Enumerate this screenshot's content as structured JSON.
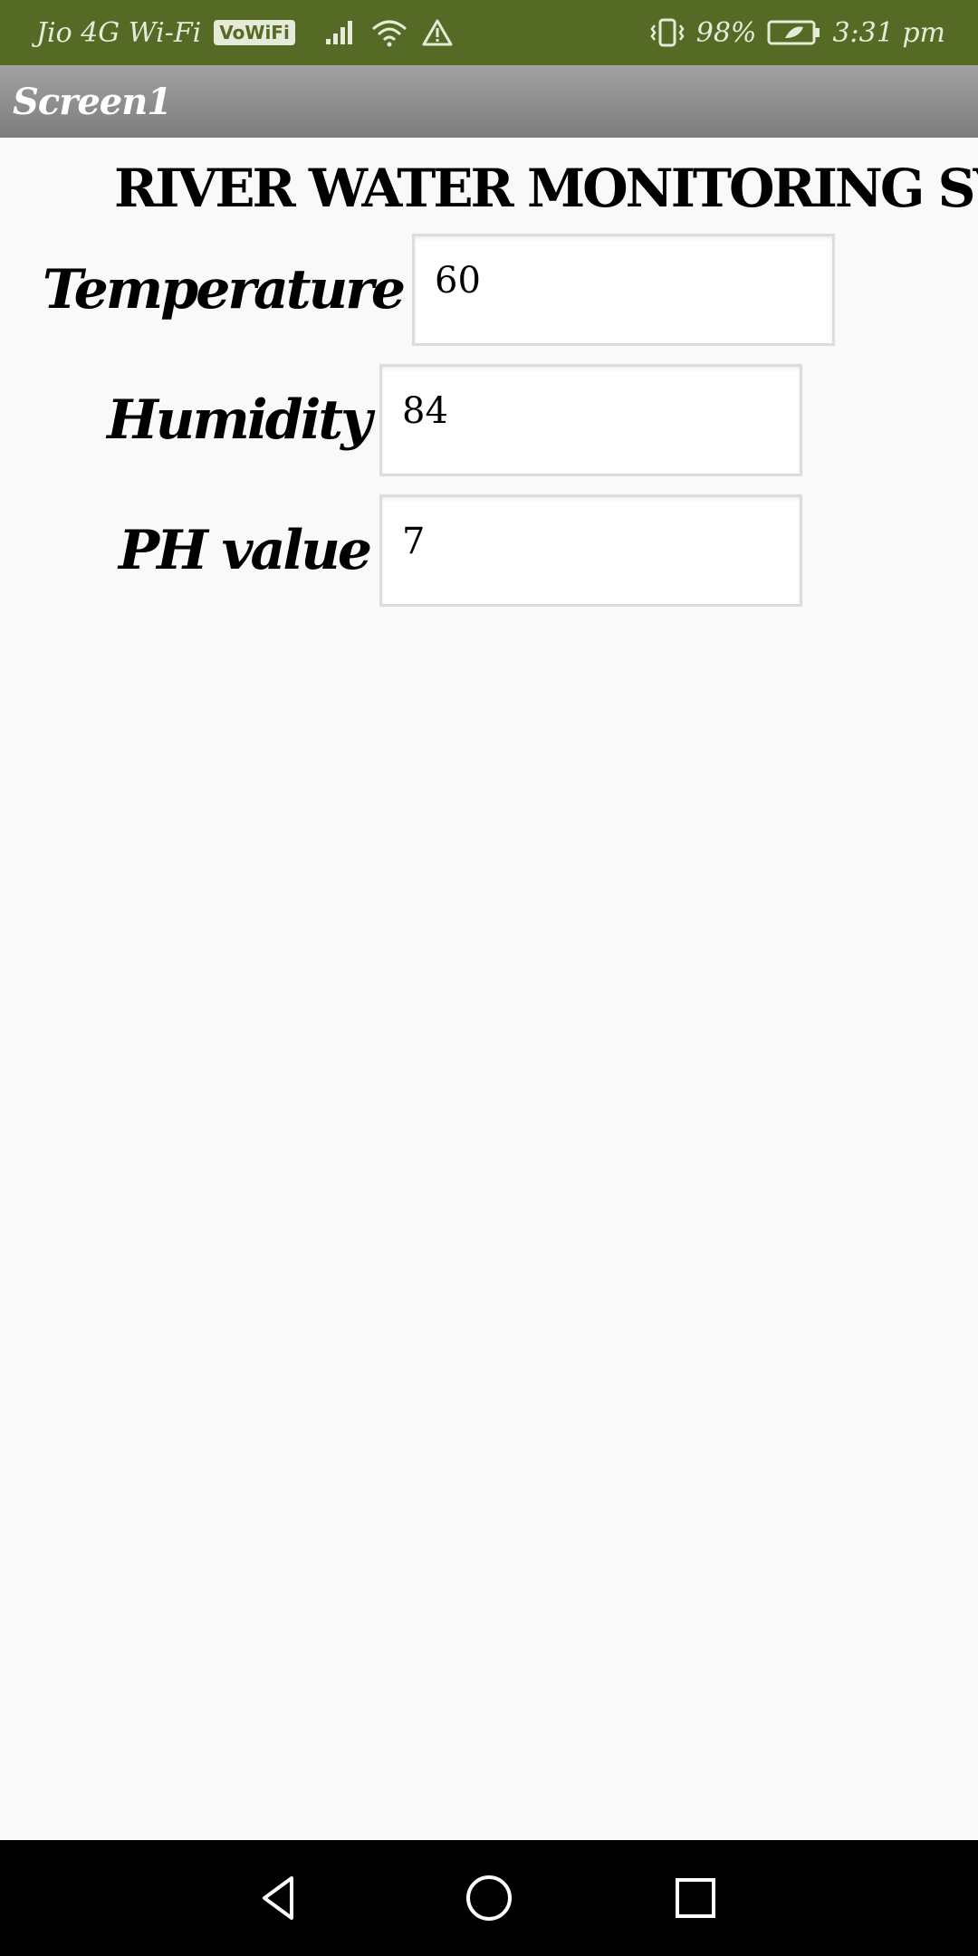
{
  "status_bar": {
    "carrier": "Jio 4G Wi-Fi",
    "vowifi_badge": "VoWiFi",
    "battery_percent": "98%",
    "time": "3:31 pm",
    "icons": [
      "signal-icon",
      "wifi-icon",
      "warning-icon",
      "vibrate-icon",
      "battery-icon"
    ]
  },
  "title_bar": {
    "title": "Screen1"
  },
  "main": {
    "heading": "RIVER WATER MONITORING SYSTEM",
    "fields": [
      {
        "label": "Temperature",
        "value": "60"
      },
      {
        "label": "Humidity",
        "value": "84"
      },
      {
        "label": "PH value",
        "value": "7"
      }
    ]
  },
  "nav_bar": {
    "icons": [
      "back-icon",
      "home-icon",
      "recents-icon"
    ]
  },
  "colors": {
    "status_bar": "#556b25",
    "title_bar": "#8f8f8f",
    "background": "#f9f9f9",
    "nav_bar": "#000000"
  }
}
